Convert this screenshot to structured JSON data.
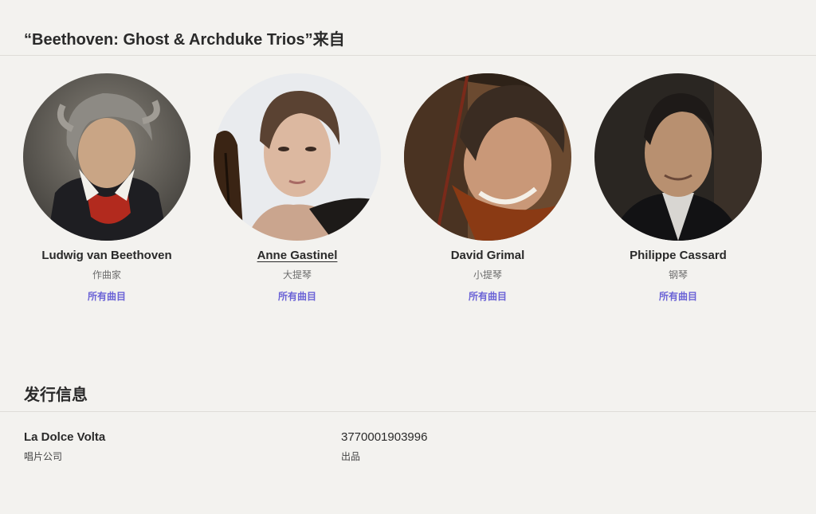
{
  "credits": {
    "title": "“Beethoven: Ghost & Archduke Trios”来自",
    "artists": [
      {
        "name": "Ludwig van Beethoven",
        "role": "作曲家",
        "link": "所有曲目"
      },
      {
        "name": "Anne Gastinel",
        "role": "大提琴",
        "link": "所有曲目"
      },
      {
        "name": "David Grimal",
        "role": "小提琴",
        "link": "所有曲目"
      },
      {
        "name": "Philippe Cassard",
        "role": "钢琴",
        "link": "所有曲目"
      }
    ]
  },
  "release": {
    "title": "发行信息",
    "label": {
      "value": "La Dolce Volta",
      "caption": "唱片公司"
    },
    "product": {
      "value": "3770001903996",
      "caption": "出品"
    }
  }
}
